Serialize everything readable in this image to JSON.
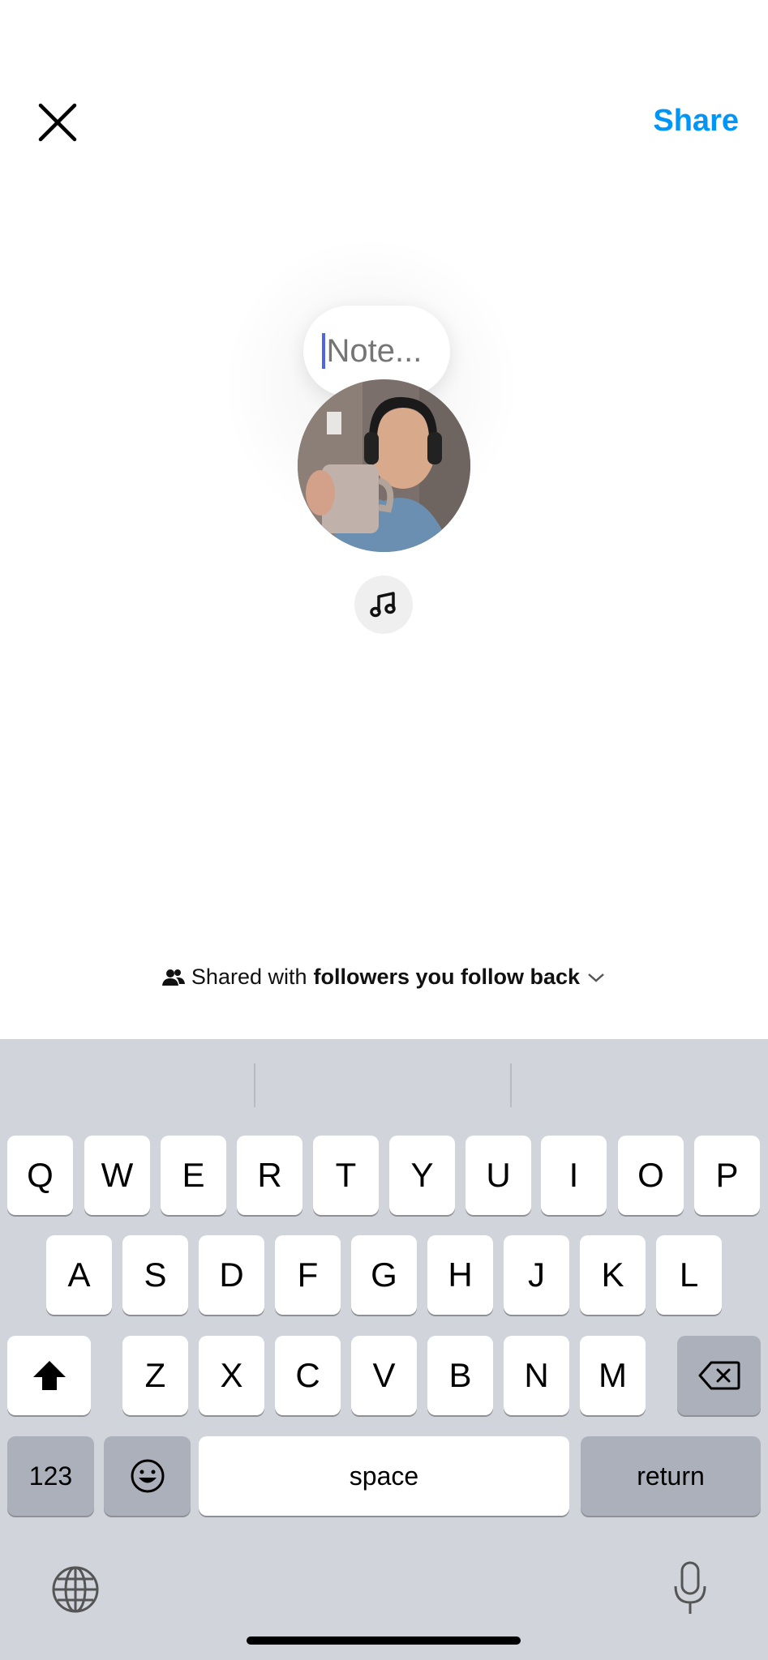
{
  "header": {
    "share_label": "Share"
  },
  "note": {
    "placeholder": "Note..."
  },
  "audience": {
    "prefix": "Shared with",
    "group": "followers you follow back"
  },
  "keyboard": {
    "row1": [
      "Q",
      "W",
      "E",
      "R",
      "T",
      "Y",
      "U",
      "I",
      "O",
      "P"
    ],
    "row2": [
      "A",
      "S",
      "D",
      "F",
      "G",
      "H",
      "J",
      "K",
      "L"
    ],
    "row3": [
      "Z",
      "X",
      "C",
      "V",
      "B",
      "N",
      "M"
    ],
    "numbers_label": "123",
    "space_label": "space",
    "return_label": "return"
  },
  "colors": {
    "accent": "#0095f6",
    "caret": "#4c66e6",
    "keyboard_bg": "#d1d4da"
  },
  "icons": [
    "close-icon",
    "music-note-icon",
    "people-icon",
    "chevron-down-icon",
    "shift-icon",
    "backspace-icon",
    "emoji-icon",
    "globe-icon",
    "microphone-icon"
  ]
}
